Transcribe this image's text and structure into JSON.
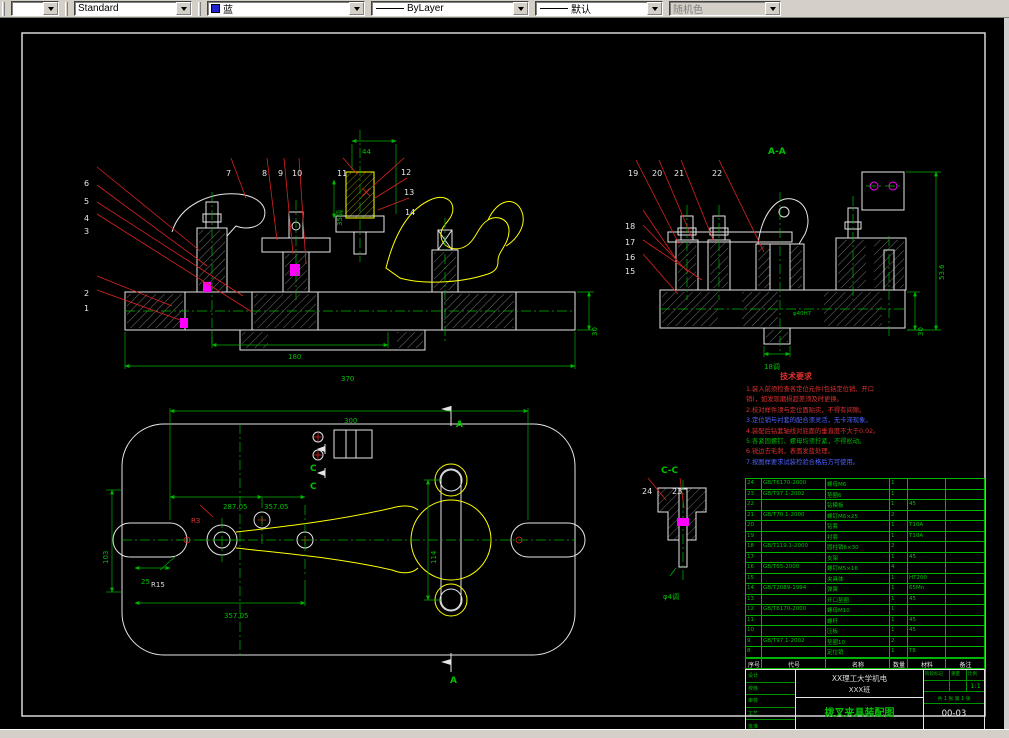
{
  "toolbar": {
    "workspace_value": "",
    "style_value": "Standard",
    "color_value": "蓝",
    "color_swatch": "#2222cc",
    "linetype_value": "ByLayer",
    "lineweight_value": "默认",
    "plotstyle_value": "随机色"
  },
  "views": {
    "front": {
      "callouts": {
        "c1": "1",
        "c2": "2",
        "c3": "3",
        "c4": "4",
        "c5": "5",
        "c6": "6",
        "c7": "7",
        "c8": "8",
        "c9": "9",
        "c10": "10",
        "c11": "11",
        "c12": "12",
        "c13": "13",
        "c14": "14"
      },
      "dims": {
        "w180": "180",
        "w370": "370",
        "h30": "30",
        "t44": "44",
        "t35": "35调"
      }
    },
    "aa": {
      "label": "A-A",
      "callouts": {
        "c15": "15",
        "c16": "16",
        "c17": "17",
        "c18": "18",
        "c19": "19",
        "c20": "20",
        "c21": "21",
        "c22": "22"
      },
      "dims": {
        "t18": "18调",
        "h30": "30",
        "h536": "53.6",
        "hole": "φ40H7"
      }
    },
    "plan": {
      "dims": {
        "w300": "300",
        "a287": "287.05",
        "a357": "357.05",
        "b357": "357.05",
        "h103": "103",
        "w25": "25",
        "r3": "R3",
        "r15": "R15",
        "h114": "114"
      },
      "sec": {
        "a": "A",
        "c": "C"
      }
    },
    "cc": {
      "label": "C-C",
      "c23": "23",
      "c24": "24",
      "dim": "φ4调"
    }
  },
  "notes": {
    "title": "技术要求",
    "lines": [
      {
        "text": "1.装入前须检查各定位元件(包括定位销、开口",
        "color": "#e03030"
      },
      {
        "text": "销)，如发现磨损超差须及时更换。",
        "color": "#e03030"
      },
      {
        "text": "2.校对样件须与定位面贴实，不得有间隙。",
        "color": "#e03030"
      },
      {
        "text": "3.定位销与衬套的配合须灵活，无卡滞现象。",
        "color": "#5060ff"
      },
      {
        "text": "4.装配后钻套轴线对底面的垂直度不大于0.02。",
        "color": "#e03030"
      },
      {
        "text": "5.各紧固螺钉、螺母均须拧紧，不得松动。",
        "color": "#00b400"
      },
      {
        "text": "6.锐边去毛刺，表面发蓝处理。",
        "color": "#e03030"
      },
      {
        "text": "7.按图样要求试装检验合格后方可使用。",
        "color": "#5060ff"
      }
    ]
  },
  "bom": {
    "headers": [
      "序号",
      "代号",
      "名称",
      "数量",
      "材料",
      "备注"
    ],
    "rows": [
      {
        "no": "24",
        "code": "GB/T6170-2000",
        "name": "螺母M6",
        "qty": "1",
        "mat": "",
        "rem": ""
      },
      {
        "no": "23",
        "code": "GB/T97.1-2002",
        "name": "垫圈6",
        "qty": "1",
        "mat": "",
        "rem": ""
      },
      {
        "no": "22",
        "code": "",
        "name": "钻模板",
        "qty": "1",
        "mat": "45",
        "rem": ""
      },
      {
        "no": "21",
        "code": "GB/T70.1-2000",
        "name": "螺钉M6×25",
        "qty": "2",
        "mat": "",
        "rem": ""
      },
      {
        "no": "20",
        "code": "",
        "name": "钻套",
        "qty": "1",
        "mat": "T10A",
        "rem": ""
      },
      {
        "no": "19",
        "code": "",
        "name": "衬套",
        "qty": "1",
        "mat": "T10A",
        "rem": ""
      },
      {
        "no": "18",
        "code": "GB/T119.1-2000",
        "name": "圆柱销6×30",
        "qty": "2",
        "mat": "",
        "rem": ""
      },
      {
        "no": "17",
        "code": "",
        "name": "支架",
        "qty": "1",
        "mat": "45",
        "rem": ""
      },
      {
        "no": "16",
        "code": "GB/T65-2000",
        "name": "螺钉M5×16",
        "qty": "4",
        "mat": "",
        "rem": ""
      },
      {
        "no": "15",
        "code": "",
        "name": "夹具体",
        "qty": "1",
        "mat": "HT200",
        "rem": ""
      },
      {
        "no": "14",
        "code": "GB/T2089-1994",
        "name": "弹簧",
        "qty": "1",
        "mat": "65Mn",
        "rem": ""
      },
      {
        "no": "13",
        "code": "",
        "name": "开口垫圈",
        "qty": "1",
        "mat": "45",
        "rem": ""
      },
      {
        "no": "12",
        "code": "GB/T6170-2000",
        "name": "螺母M10",
        "qty": "1",
        "mat": "",
        "rem": ""
      },
      {
        "no": "11",
        "code": "",
        "name": "螺杆",
        "qty": "1",
        "mat": "45",
        "rem": ""
      },
      {
        "no": "10",
        "code": "",
        "name": "压板",
        "qty": "1",
        "mat": "45",
        "rem": ""
      },
      {
        "no": "9",
        "code": "GB/T97.1-2002",
        "name": "垫圈10",
        "qty": "2",
        "mat": "",
        "rem": ""
      },
      {
        "no": "8",
        "code": "",
        "name": "定位销",
        "qty": "1",
        "mat": "T8",
        "rem": ""
      }
    ]
  },
  "titleblock": {
    "school1": "XX理工大学机电",
    "school2": "XXX班",
    "title": "拨叉夹具装配图",
    "stage": "阶段标记",
    "weight": "重量",
    "scale_label": "比例",
    "scale": "1:1",
    "sheet": "共 1 张 第 1 张",
    "number": "00-03",
    "left_rows": [
      {
        "label": "设计"
      },
      {
        "label": "校核"
      },
      {
        "label": "审核"
      },
      {
        "label": "工艺"
      },
      {
        "label": "批准"
      }
    ]
  }
}
